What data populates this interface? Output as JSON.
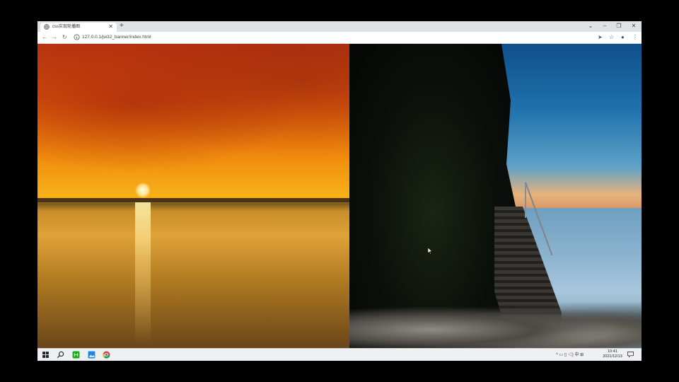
{
  "browser": {
    "tab_title": "css实现轮播图",
    "tab_close": "✕",
    "new_tab": "+",
    "url": "127.0.0.1/jw32_banner/index.html",
    "nav": {
      "back": "←",
      "forward": "→",
      "reload": "↻"
    },
    "window_controls": {
      "dropdown": "⌄",
      "minimize": "–",
      "restore": "❐",
      "close": "✕"
    },
    "toolbar_icons": {
      "send": "➤",
      "bookmark": "☆",
      "profile": "●",
      "menu": "⋮"
    }
  },
  "banner": {
    "slides": [
      {
        "name": "sunset-over-water"
      },
      {
        "name": "cliff-staircase-by-sea"
      }
    ]
  },
  "taskbar": {
    "tray_text": "^ ▭ ▯ ◁) 中 ⊞",
    "time": "10:41",
    "date": "2021/12/13"
  },
  "colors": {
    "tabstrip": "#dee1e6",
    "taskbar": "#eef0f2",
    "accent_green": "#1aad19",
    "accent_blue": "#1e88e5"
  }
}
